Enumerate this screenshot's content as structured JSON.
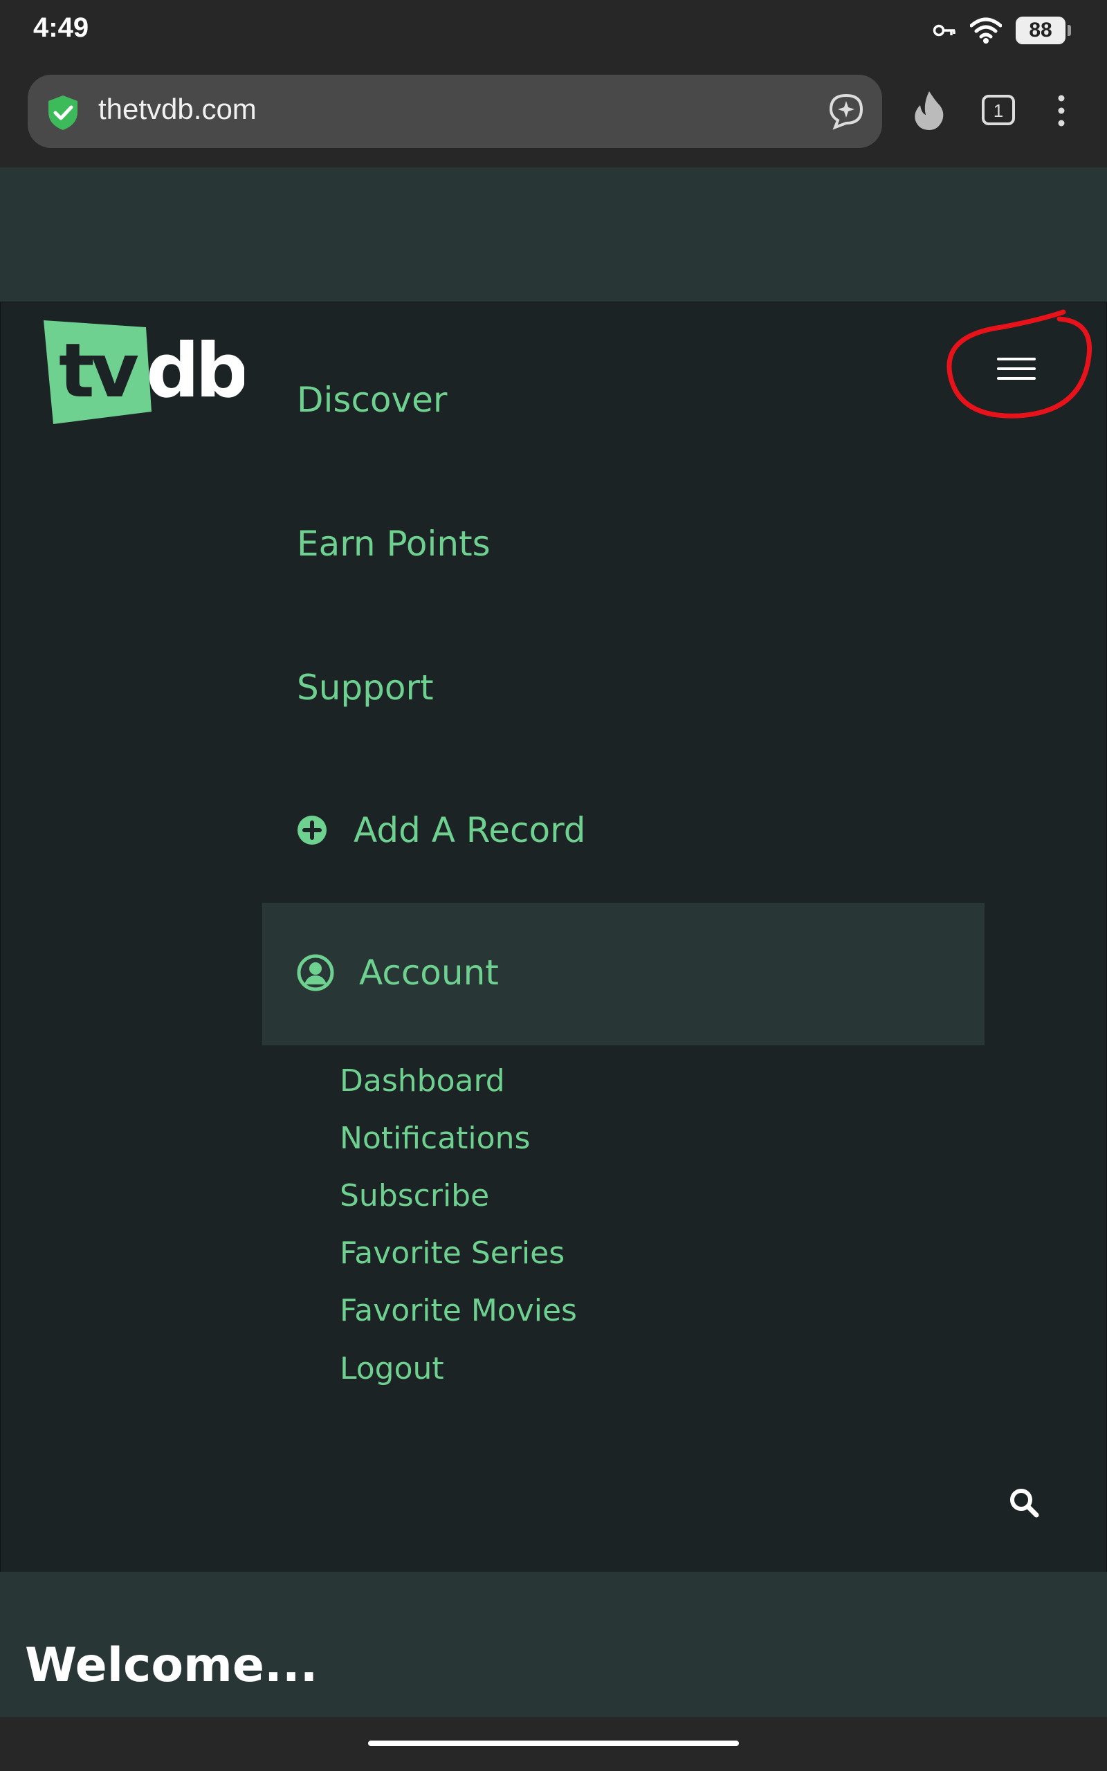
{
  "status_bar": {
    "time": "4:49",
    "battery": "88"
  },
  "browser": {
    "url": "thetvdb.com",
    "tab_count": "1"
  },
  "site": {
    "logo_text": "tvdb",
    "nav": [
      {
        "label": "Discover"
      },
      {
        "label": "Earn Points"
      },
      {
        "label": "Support"
      },
      {
        "label": "Add A Record"
      },
      {
        "label": "Account"
      }
    ],
    "account_submenu": [
      "Dashboard",
      "Notifications",
      "Subscribe",
      "Favorite Series",
      "Favorite Movies",
      "Logout"
    ],
    "welcome": "Welcome..."
  },
  "colors": {
    "accent": "#6ed190",
    "panel_bg": "#1b2325",
    "band_bg": "#283736",
    "annotation": "#e8121a"
  }
}
